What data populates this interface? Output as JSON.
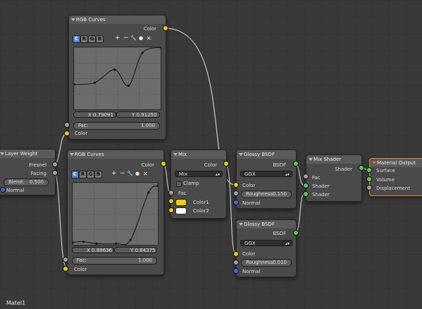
{
  "footer": {
    "material_name": "Matel1"
  },
  "nodes": {
    "layer_weight": {
      "title": "Layer Weight",
      "fresnel": "Fresnel",
      "facing": "Facing",
      "blend_label": "Blend:",
      "blend_value": "0.500",
      "normal": "Normal"
    },
    "rgb_curves_1": {
      "title": "RGB Curves",
      "output": "Color",
      "channels": [
        "C",
        "R",
        "G",
        "B"
      ],
      "tools": [
        "+",
        "−",
        "🔧",
        "●",
        "✕"
      ],
      "x_readout": "X 0.79091",
      "y_readout": "Y 0.91250",
      "fac_label": "Fac:",
      "fac_value": "1.000",
      "input": "Color"
    },
    "rgb_curves_2": {
      "title": "RGB Curves",
      "output": "Color",
      "channels": [
        "C",
        "R",
        "G",
        "B"
      ],
      "tools": [
        "+",
        "−",
        "🔧",
        "●",
        "✕"
      ],
      "x_readout": "X 0.88636",
      "y_readout": "Y 0.84375",
      "fac_label": "Fac:",
      "fac_value": "1.000",
      "input": "Color"
    },
    "mix": {
      "title": "Mix",
      "output": "Color",
      "blend_mode": "Mix",
      "clamp": "Clamp",
      "fac": "Fac",
      "color1": "Color1",
      "color2": "Color2",
      "color1_value": "#f0d000",
      "color2_value": "#ffffff"
    },
    "glossy_1": {
      "title": "Glossy BSDF",
      "output": "BSDF",
      "distribution": "GGX",
      "color": "Color",
      "roughness_label": "Roughness:",
      "roughness_value": "0.150",
      "normal": "Normal"
    },
    "glossy_2": {
      "title": "Glossy BSDF",
      "output": "BSDF",
      "distribution": "GGX",
      "color": "Color",
      "roughness_label": "Roughness:",
      "roughness_value": "0.010",
      "normal": "Normal"
    },
    "mix_shader": {
      "title": "Mix Shader",
      "output": "Shader",
      "fac": "Fac",
      "shader1": "Shader",
      "shader2": "Shader"
    },
    "material_output": {
      "title": "Material Output",
      "surface": "Surface",
      "volume": "Volume",
      "displacement": "Displacement"
    }
  },
  "curves": {
    "curve_1": [
      [
        0.0,
        0.4
      ],
      [
        0.24,
        0.43
      ],
      [
        0.47,
        0.64
      ],
      [
        0.63,
        0.38
      ],
      [
        0.79,
        0.91
      ],
      [
        1.0,
        1.0
      ]
    ],
    "curve_2": [
      [
        0.0,
        0.04
      ],
      [
        0.13,
        0.05
      ],
      [
        0.28,
        0.02
      ],
      [
        0.51,
        0.02
      ],
      [
        0.68,
        0.08
      ],
      [
        0.89,
        0.84
      ],
      [
        1.0,
        0.95
      ]
    ]
  },
  "colors": {
    "active_node_border": "#e08a30",
    "socket_color": "#e0d010",
    "socket_shader": "#50d050",
    "socket_vector": "#6060d0",
    "socket_float": "#a0a0a0"
  }
}
